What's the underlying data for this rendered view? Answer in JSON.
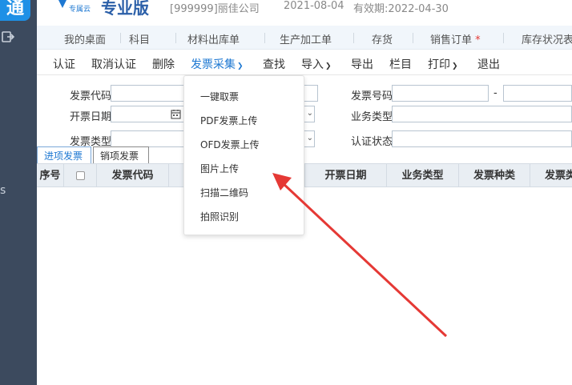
{
  "sidebar": {
    "logo_glyph": "通",
    "brand_color": "#1e90e6",
    "bg_color": "#3c4a5e",
    "mark": "s"
  },
  "header": {
    "brand_sub": "专属云",
    "brand_title": "专业版",
    "company": "[999999]丽佳公司",
    "date": "2021-08-04",
    "validity": "有效期:2022-04-30"
  },
  "tabs": [
    {
      "label": "我的桌面"
    },
    {
      "label": "科目"
    },
    {
      "label": "材料出库单"
    },
    {
      "label": "生产加工单"
    },
    {
      "label": "存货"
    },
    {
      "label": "销售订单",
      "star": "*"
    },
    {
      "label": "库存状况表"
    }
  ],
  "toolbar": {
    "items": [
      "认证",
      "取消认证",
      "删除",
      "发票采集",
      "查找",
      "导入",
      "导出",
      "栏目",
      "打印",
      "退出"
    ],
    "accent": "#1e78d2"
  },
  "filter": {
    "invoice_code_label": "发票代码",
    "invoice_number_label": "发票号码",
    "issue_date_label": "开票日期",
    "business_type_label": "业务类型",
    "invoice_type_label": "发票类型",
    "auth_status_label": "认证状态",
    "range_separator": "-"
  },
  "subtabs": {
    "incoming": "进项发票",
    "outgoing": "销项发票"
  },
  "table": {
    "columns": [
      "序号",
      "",
      "发票代码",
      "",
      "开票日期",
      "业务类型",
      "发票种类",
      "发票类"
    ]
  },
  "dropdown": {
    "items": [
      "一键取票",
      "PDF发票上传",
      "OFD发票上传",
      "图片上传",
      "扫描二维码",
      "拍照识别"
    ]
  },
  "annotation": {
    "arrow_color": "#e53935"
  }
}
